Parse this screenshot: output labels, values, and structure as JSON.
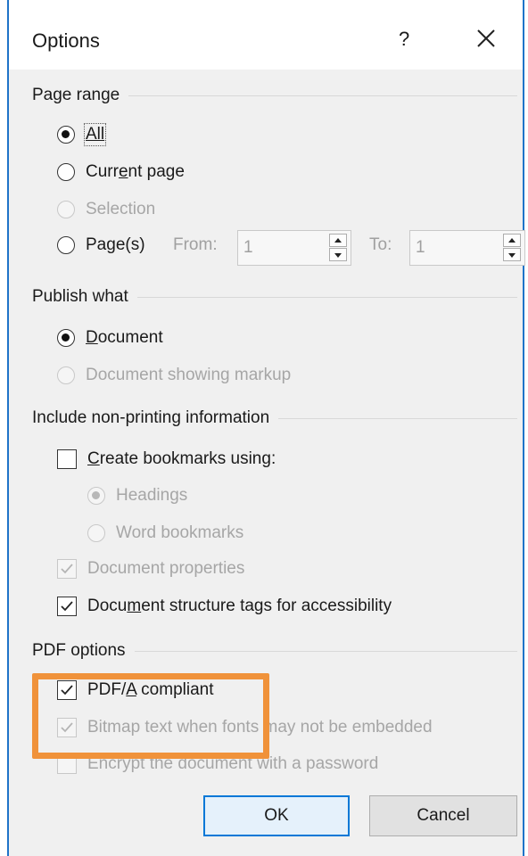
{
  "window": {
    "title": "Options",
    "help_glyph": "?"
  },
  "page_range": {
    "label": "Page range",
    "all": "All",
    "current_page": {
      "pre": "Curr",
      "accel": "e",
      "post": "nt page"
    },
    "selection": "Selection",
    "pages": {
      "pre": "Pa",
      "accel": "g",
      "post": "e(s)"
    },
    "from_label": "From:",
    "from_value": "1",
    "to_label": "To:",
    "to_value": "1"
  },
  "publish_what": {
    "label": "Publish what",
    "document": {
      "accel": "D",
      "post": "ocument"
    },
    "document_markup": "Document showing markup"
  },
  "non_printing": {
    "label": "Include non-printing information",
    "create_bookmarks": {
      "accel": "C",
      "post": "reate bookmarks using:"
    },
    "headings": "Headings",
    "word_bookmarks": "Word bookmarks",
    "document_properties": "Document properties",
    "structure_tags": {
      "pre": "Docu",
      "accel": "m",
      "post": "ent structure tags for accessibility"
    }
  },
  "pdf_options": {
    "label": "PDF options",
    "pdfa": {
      "pre": "PDF/",
      "accel": "A",
      "post": " compliant"
    },
    "bitmap_text": "Bitmap text when fonts may not be embedded",
    "encrypt": "Encrypt the document with a password"
  },
  "buttons": {
    "ok": "OK",
    "cancel": "Cancel"
  },
  "colors": {
    "accent": "#1f73c8",
    "highlight": "#f0923a",
    "default_button": "#0078d7"
  }
}
